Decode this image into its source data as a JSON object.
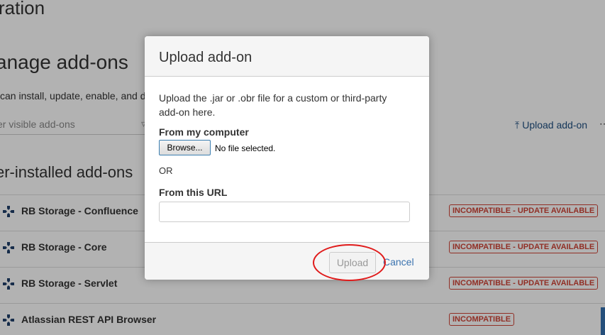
{
  "background": {
    "page_title": "ration",
    "section_title": "anage add-ons",
    "description": "can install, update, enable, and d",
    "filter_placeholder": "er visible add-ons",
    "upload_link": "Upload add-on",
    "user_installed_title": "er-installed add-ons",
    "addons": [
      {
        "name": "RB Storage - Confluence",
        "status": "INCOMPATIBLE - UPDATE AVAILABLE"
      },
      {
        "name": "RB Storage - Core",
        "status": "INCOMPATIBLE - UPDATE AVAILABLE"
      },
      {
        "name": "RB Storage - Servlet",
        "status": "INCOMPATIBLE - UPDATE AVAILABLE"
      },
      {
        "name": "Atlassian REST API Browser",
        "status": "INCOMPATIBLE"
      }
    ]
  },
  "dialog": {
    "title": "Upload add-on",
    "description": "Upload the .jar or .obr file for a custom or third-party add-on here.",
    "from_computer_label": "From my computer",
    "browse_label": "Browse...",
    "file_status": "No file selected.",
    "or_label": "OR",
    "from_url_label": "From this URL",
    "url_value": "",
    "upload_label": "Upload",
    "cancel_label": "Cancel"
  },
  "icons": {
    "addon": "puzzle-cross-icon",
    "filter": "filter-icon",
    "upload": "upload-arrow-icon"
  },
  "colors": {
    "link": "#205081",
    "badge": "#d04437",
    "annotation": "#e01b1b"
  }
}
